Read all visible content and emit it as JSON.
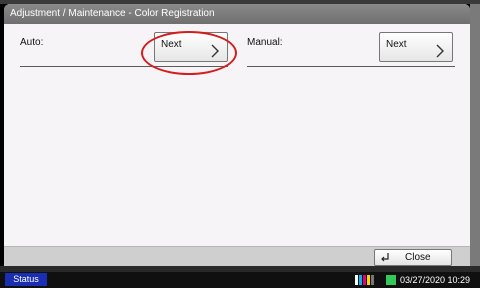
{
  "window": {
    "title": "Adjustment / Maintenance - Color Registration"
  },
  "auto": {
    "label": "Auto:",
    "next_label": "Next"
  },
  "manual": {
    "label": "Manual:",
    "next_label": "Next"
  },
  "footer": {
    "close_label": "Close"
  },
  "status_bar": {
    "status_label": "Status",
    "datetime": "03/27/2020 10:29"
  },
  "colors": {
    "highlight": "#d21e1e",
    "status_button": "#1a2eb3",
    "title_bar": "#7a7a7a"
  }
}
